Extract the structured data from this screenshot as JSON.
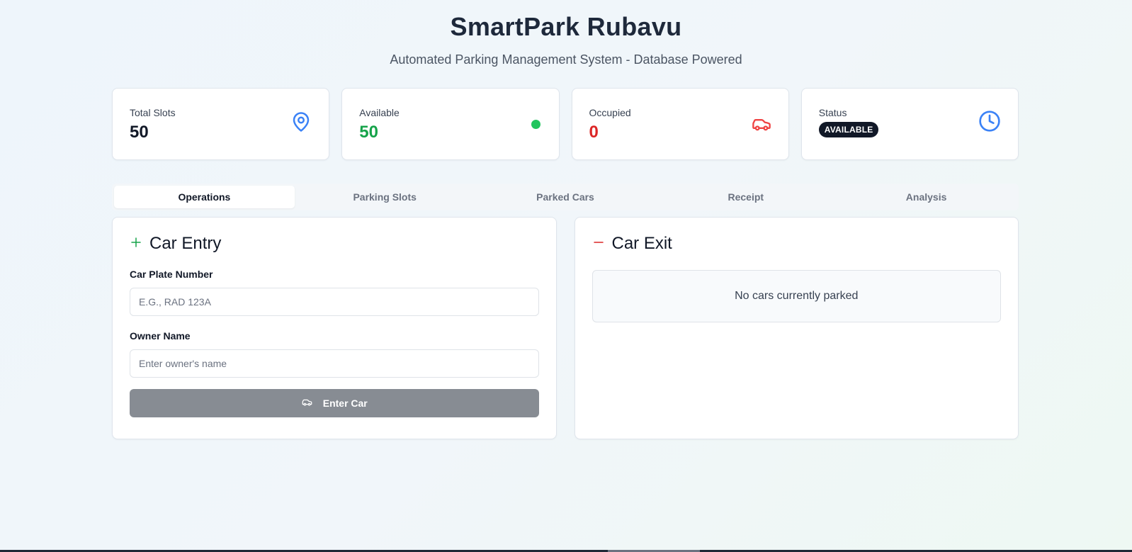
{
  "header": {
    "title": "SmartPark Rubavu",
    "subtitle": "Automated Parking Management System - Database Powered"
  },
  "stats": [
    {
      "label": "Total Slots",
      "value": "50",
      "icon": "map-pin-icon",
      "value_color": "#111827"
    },
    {
      "label": "Available",
      "value": "50",
      "icon": "green-dot-icon",
      "value_color": "#16a34a"
    },
    {
      "label": "Occupied",
      "value": "0",
      "icon": "car-icon",
      "value_color": "#dc2626"
    },
    {
      "label": "Status",
      "badge": "AVAILABLE",
      "icon": "clock-icon"
    }
  ],
  "tabs": [
    {
      "label": "Operations",
      "active": true
    },
    {
      "label": "Parking Slots",
      "active": false
    },
    {
      "label": "Parked Cars",
      "active": false
    },
    {
      "label": "Receipt",
      "active": false
    },
    {
      "label": "Analysis",
      "active": false
    }
  ],
  "entry": {
    "title": "Car Entry",
    "plate_label": "Car Plate Number",
    "plate_placeholder": "E.G., RAD 123A",
    "plate_value": "",
    "owner_label": "Owner Name",
    "owner_placeholder": "Enter owner's name",
    "owner_value": "",
    "button_label": "Enter Car"
  },
  "exit": {
    "title": "Car Exit",
    "empty_message": "No cars currently parked"
  },
  "colors": {
    "accent_blue": "#3b82f6",
    "success_green": "#16a34a",
    "danger_red": "#dc2626",
    "disabled_button": "#878c93"
  }
}
